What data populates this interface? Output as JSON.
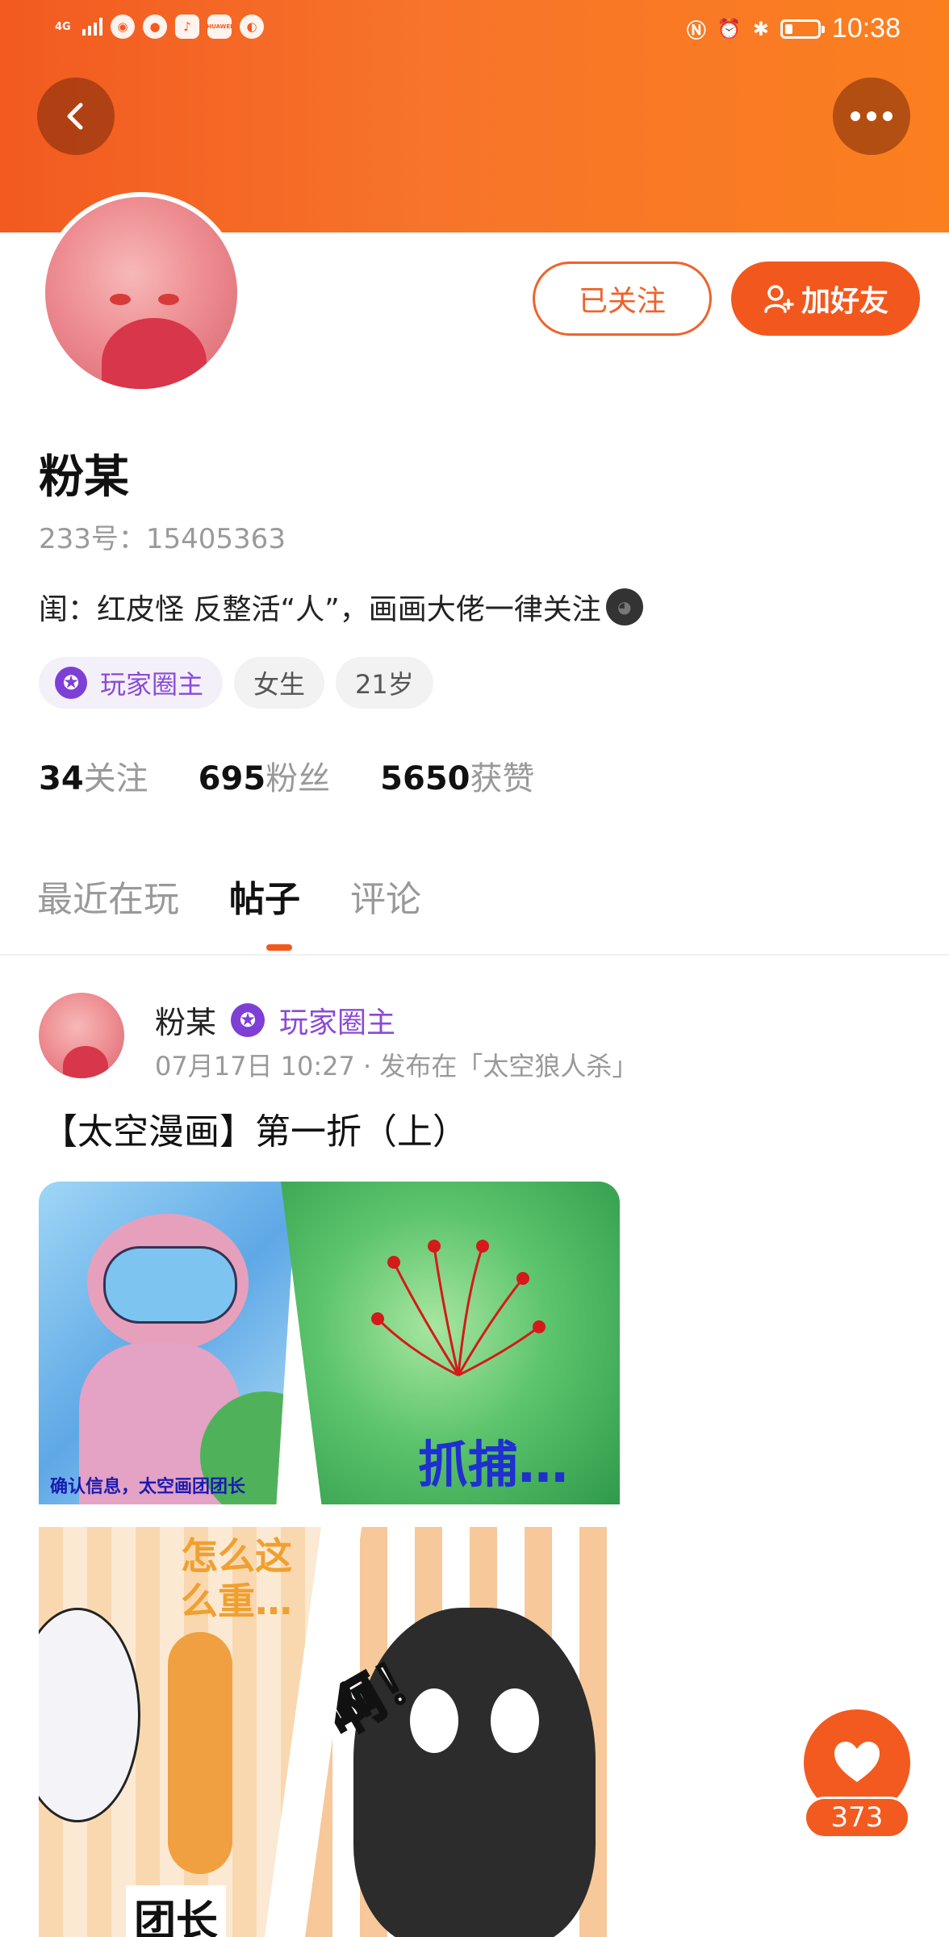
{
  "status_bar": {
    "network": "4G",
    "time": "10:38",
    "icons": [
      "signal-icon",
      "wechat-icon",
      "message-icon",
      "music-icon",
      "huawei-icon",
      "browser-icon",
      "nfc-icon",
      "alarm-icon",
      "bluetooth-icon",
      "battery-icon"
    ],
    "battery_level": 0.25,
    "app_huawei": "HUAWEI"
  },
  "header": {
    "background_color": "#f25a20",
    "back_icon": "chevron-left-icon",
    "more_icon": "more-dots-icon"
  },
  "profile": {
    "name": "粉某",
    "uid": "233号：15405363",
    "bio": "闺：红皮怪  反整活“人”，画画大佬一律关注",
    "followed_label": "已关注",
    "add_friend_label": "加好友",
    "tags": [
      {
        "label": "玩家圈主",
        "icon": "star-badge-icon"
      },
      {
        "label": "女生"
      },
      {
        "label": "21岁"
      }
    ],
    "stats": [
      {
        "value": "34",
        "label": "关注"
      },
      {
        "value": "695",
        "label": "粉丝"
      },
      {
        "value": "5650",
        "label": "获赞"
      }
    ]
  },
  "tabs": [
    {
      "label": "最近在玩",
      "active": false
    },
    {
      "label": "帖子",
      "active": true
    },
    {
      "label": "评论",
      "active": false
    }
  ],
  "post": {
    "author": "粉某",
    "author_role": "玩家圈主",
    "meta": "07月17日 10:27 · 发布在「太空狼人杀」",
    "title": "【太空漫画】第一折（上）",
    "comic_text": {
      "panel1": "确认信息，太空画团团长",
      "panel2": "抓捕…",
      "panel3_top": "怎么这么重…",
      "panel3_bottom": "团长",
      "panel4": "啊！"
    }
  },
  "like": {
    "icon": "heart-icon",
    "count": "373"
  },
  "colors": {
    "accent": "#f2581e",
    "purple": "#8a4ad8"
  }
}
